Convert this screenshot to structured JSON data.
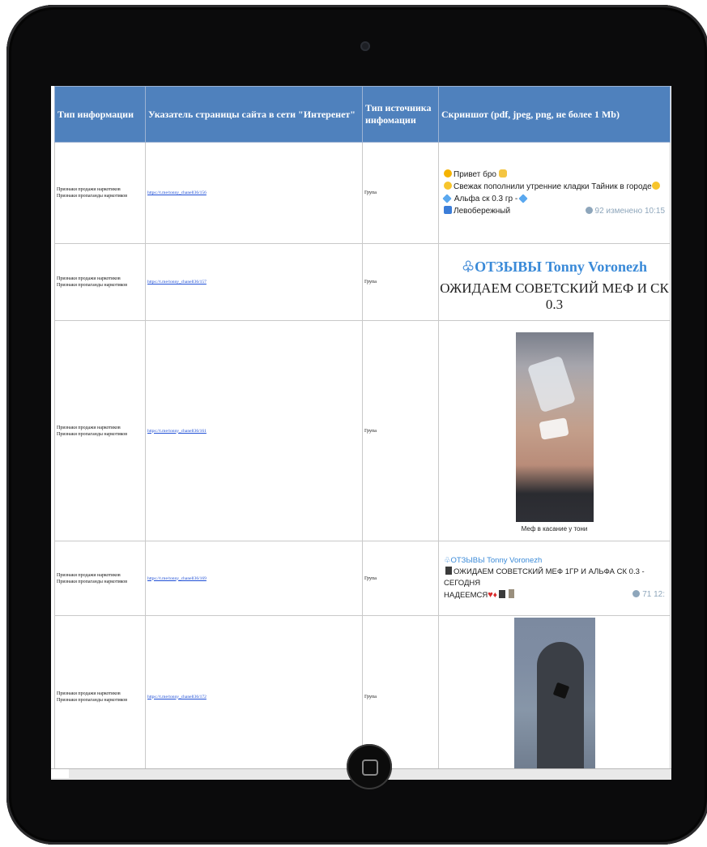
{
  "table": {
    "headers": [
      "Тип информации",
      "Указатель страницы сайта в сети \"Интеренет\"",
      "Тип источника инфомации",
      "Скриншот (pdf, jpeg, png, не более 1 Mb)"
    ],
    "rows": [
      {
        "info_line1": "Признаки продажи наркотиков",
        "info_line2": "Признаки пропаганды наркотиков",
        "url": "https://t.me/tonny_chanell36/156",
        "source": "Група"
      },
      {
        "info_line1": "Признаки продажи наркотиков",
        "info_line2": "Признаки пропаганды наркотиков",
        "url": "https://t.me/tonny_chanell36/157",
        "source": "Група"
      },
      {
        "info_line1": "Признаки продажи наркотиков",
        "info_line2": "Признаки пропаганды наркотиков",
        "url": "https://t.me/tonny_chanell36/161",
        "source": "Група"
      },
      {
        "info_line1": "Признаки продажи наркотиков",
        "info_line2": "Признаки пропаганды наркотиков",
        "url": "https://t.me/tonny_chanell36/169",
        "source": "Група"
      },
      {
        "info_line1": "Признаки продажи наркотиков",
        "info_line2": "Признаки пропаганды наркотиков",
        "url": "https://t.me/tonny_chanell36/172",
        "source": "Група"
      }
    ]
  },
  "screenshots": {
    "r1": {
      "line1": "Привет бро",
      "line2": "Свежак пополнили утренние кладки Тайник в городе",
      "line3": "Альфа ск 0.3 гр -",
      "line4": "Левобережный",
      "views": "92",
      "edited": "изменено 10:15"
    },
    "r2": {
      "line1": "ОТЗЫВЫ Tonny Voronezh",
      "line2": "ОЖИДАЕМ СОВЕТСКИЙ МЕФ И СК 0.3"
    },
    "r3": {
      "caption": "Меф в касание у тони"
    },
    "r4": {
      "line1": "ОТЗЫВЫ Tonny Voronezh",
      "line2": "ОЖИДАЕМ СОВЕТСКИЙ МЕФ 1ГР И АЛЬФА СК 0.3 - СЕГОДНЯ",
      "line3": "НАДЕЕМСЯ",
      "views": "71",
      "time": "12:"
    }
  },
  "icons": {
    "camera": "front-camera-icon",
    "home": "home-button-icon",
    "views": "eye-icon"
  },
  "colors": {
    "header_bg": "#4f81bd",
    "link": "#1f4fd6",
    "device": "#0b0b0c",
    "telegram_blue": "#3a8ad8"
  }
}
